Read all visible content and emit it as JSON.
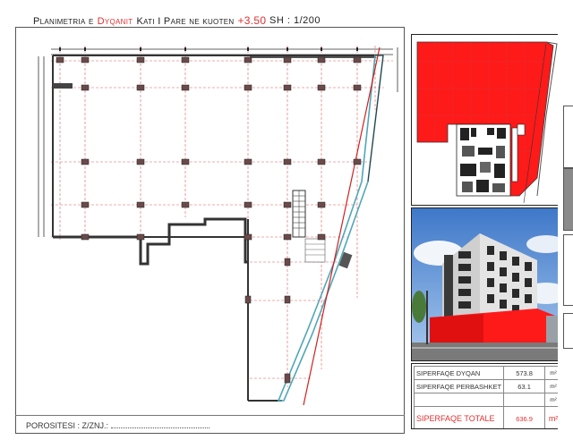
{
  "title": {
    "prefix": "Planimetria e",
    "highlight": "Dyqanit",
    "middle": "Kati I Pare ne kuoten",
    "elevation": "+3.50"
  },
  "scale": "SH :   1/200",
  "footer": {
    "label": "POROSITESI :  Z/ZNJ.:"
  },
  "areas": {
    "rows": [
      {
        "label": "SIPERFAQE DYQAN",
        "value": "573.8",
        "unit": "m²"
      },
      {
        "label": "SIPERFAQE PERBASHKET",
        "value": "63.1",
        "unit": "m²"
      },
      {
        "label": "",
        "value": "",
        "unit": "m²"
      }
    ],
    "total": {
      "label": "SIPERFAQE TOTALE",
      "value": "636.9",
      "unit": "m²"
    }
  },
  "colors": {
    "highlight": "#e03030",
    "shop_fill": "#ff1a1a",
    "glass_line": "#4fa6b8",
    "sky": "#5b8fd6"
  }
}
